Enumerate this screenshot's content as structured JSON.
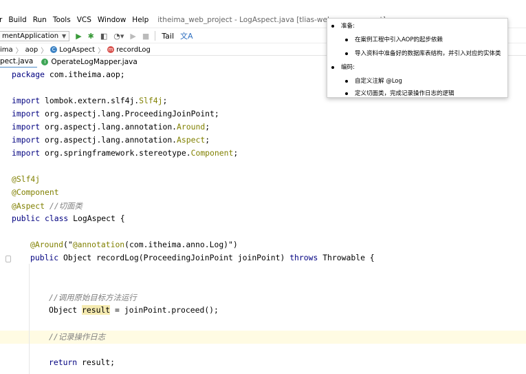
{
  "menu": {
    "items": [
      "r",
      "Build",
      "Run",
      "Tools",
      "VCS",
      "Window",
      "Help"
    ],
    "title": "itheima_web_project - LogAspect.java [tlias-web-management]"
  },
  "toolbar": {
    "run_config": "mentApplication",
    "tail": "Tail",
    "icons": [
      "run-icon",
      "debug-icon",
      "coverage-icon",
      "profile-icon",
      "play-icon",
      "stop-icon",
      "translate-icon"
    ]
  },
  "breadcrumb": [
    "ima",
    "aop",
    "LogAspect",
    "recordLog"
  ],
  "tabs": [
    {
      "label": "pect.java",
      "active": true
    },
    {
      "label": "OperateLogMapper.java",
      "active": false
    }
  ],
  "code": {
    "package": [
      "package",
      " com.itheima.aop;"
    ],
    "imports": [
      [
        "import",
        " lombok.extern.slf4j.",
        "Slf4j",
        ";"
      ],
      [
        "import",
        " org.aspectj.lang.ProceedingJoinPoint;",
        "",
        ""
      ],
      [
        "import",
        " org.aspectj.lang.annotation.",
        "Around",
        ";"
      ],
      [
        "import",
        " org.aspectj.lang.annotation.",
        "Aspect",
        ";"
      ],
      [
        "import",
        " org.springframework.stereotype.",
        "Component",
        ";"
      ]
    ],
    "ann_slf4j": "@Slf4j",
    "ann_component": "@Component",
    "ann_aspect": "@Aspect",
    "comment_aspect": "//切面类",
    "class_kw": "public class",
    "class_name": " LogAspect {",
    "around_ann": "@Around",
    "around_open": "(\"",
    "around_anno": "@annotation",
    "around_val": "(com.itheima.anno.Log)\")",
    "method_public": "public",
    "method_sig": " Object recordLog(ProceedingJoinPoint joinPoint) ",
    "method_throws": "throws",
    "method_end": " Throwable {",
    "comment_call": "//调用原始目标方法运行",
    "obj_type": "Object ",
    "result_var": "result",
    "proceed": " = joinPoint.proceed();",
    "comment_log": "//记录操作日志",
    "return_kw": "return",
    "return_val": " result;"
  },
  "popup": {
    "section1": "准备:",
    "s1_items": [
      "在案例工程中引入AOP的起步依赖",
      "导入资料中准备好的数据库表结构，并引入对应的实体类"
    ],
    "section2": "编码:",
    "s2_items": [
      "自定义注解 @Log",
      "定义切面类，完成记录操作日志的逻辑"
    ]
  }
}
